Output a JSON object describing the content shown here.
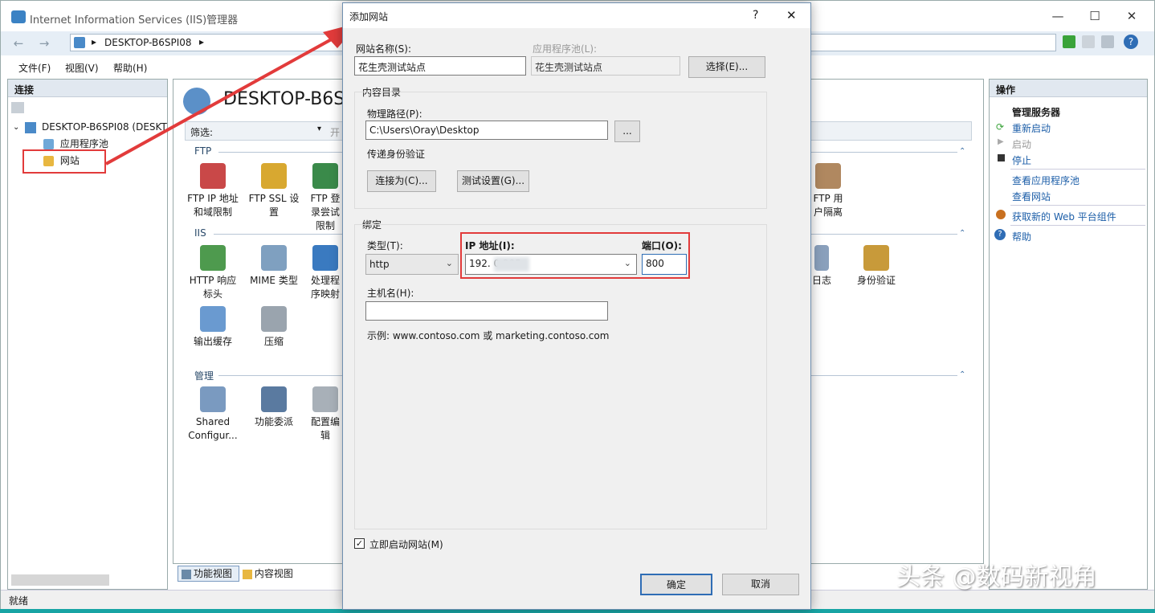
{
  "window": {
    "title": "Internet Information Services (IIS)管理器",
    "min": "—",
    "max": "☐",
    "close": "✕"
  },
  "address": {
    "sep": "▸",
    "path": "DESKTOP-B6SPI08",
    "arrow": "▸"
  },
  "menu": {
    "file": "文件(F)",
    "view": "视图(V)",
    "help": "帮助(H)"
  },
  "left": {
    "header": "连接",
    "server": "DESKTOP-B6SPI08 (DESKT",
    "apppool": "应用程序池",
    "sites": "网站"
  },
  "center": {
    "title": "DESKTOP-B6SPI",
    "filter_label": "筛选:",
    "go_label": "开",
    "groups": {
      "ftp": "FTP",
      "iis": "IIS",
      "mgmt": "管理"
    },
    "tiles": {
      "ftp_ip": "FTP IP 地址和域限制",
      "ftp_ssl": "FTP SSL 设置",
      "ftp_login": "FTP 登录尝试限制",
      "ftp_user": "FTP 用户隔离",
      "http_headers": "HTTP 响应标头",
      "mime": "MIME 类型",
      "handlers": "处理程序映射",
      "logging": "日志",
      "auth": "身份验证",
      "output_cache": "输出缓存",
      "compression": "压缩",
      "shared_config": "Shared Configur...",
      "delegation": "功能委派",
      "config_editor": "配置编辑"
    },
    "view_feature": "功能视图",
    "view_content": "内容视图"
  },
  "right": {
    "header": "操作",
    "manage_server": "管理服务器",
    "restart": "重新启动",
    "start": "启动",
    "stop": "停止",
    "view_pools": "查看应用程序池",
    "view_sites": "查看网站",
    "get_web": "获取新的 Web 平台组件",
    "help": "帮助"
  },
  "status": {
    "text": "就绪"
  },
  "dialog": {
    "title": "添加网站",
    "help_btn": "?",
    "close_btn": "✕",
    "site_name_label": "网站名称(S):",
    "site_name_value": "花生壳测试站点",
    "apppool_label": "应用程序池(L):",
    "apppool_value": "花生壳测试站点",
    "select_btn": "选择(E)...",
    "content_dir": "内容目录",
    "physical_path_label": "物理路径(P):",
    "physical_path_value": "C:\\Users\\Oray\\Desktop",
    "browse_btn": "...",
    "passthrough": "传递身份验证",
    "connect_as": "连接为(C)...",
    "test_settings": "测试设置(G)...",
    "binding": "绑定",
    "type_label": "类型(T):",
    "type_value": "http",
    "ip_label": "IP 地址(I):",
    "ip_value": "192.           0.205",
    "port_label": "端口(O):",
    "port_value": "800",
    "hostname_label": "主机名(H):",
    "hostname_value": "",
    "example": "示例: www.contoso.com 或 marketing.contoso.com",
    "start_now": "立即启动网站(M)",
    "ok": "确定",
    "cancel": "取消"
  },
  "watermark": "头条 @数码新视角",
  "colors": {
    "annotation_red": "#e23b3b",
    "accent": "#1c5ea8"
  }
}
